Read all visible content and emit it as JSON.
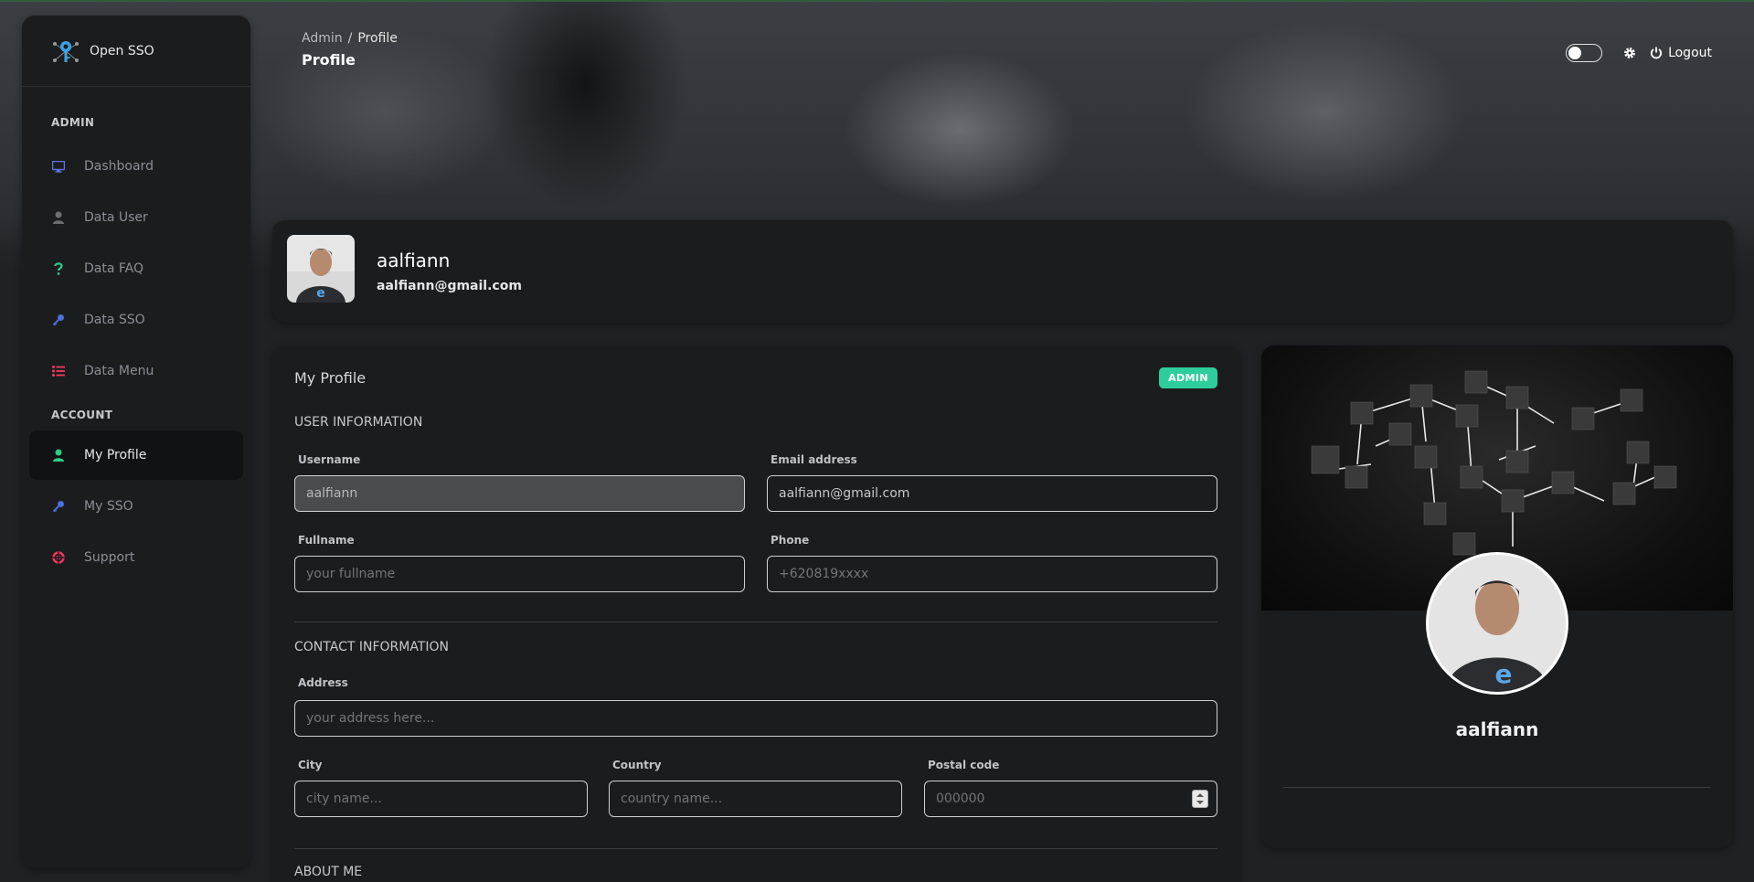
{
  "app": {
    "name": "Open SSO"
  },
  "sidebar": {
    "sections": [
      {
        "label": "ADMIN"
      },
      {
        "label": "ACCOUNT"
      }
    ],
    "items": [
      {
        "label": "Dashboard",
        "icon": "monitor-icon",
        "color": "#5e72e4"
      },
      {
        "label": "Data User",
        "icon": "user-icon",
        "color": "#6c6f73"
      },
      {
        "label": "Data FAQ",
        "icon": "question-icon",
        "color": "#2dce89"
      },
      {
        "label": "Data SSO",
        "icon": "key-icon",
        "color": "#4a6fd8"
      },
      {
        "label": "Data Menu",
        "icon": "list-icon",
        "color": "#f5365c"
      },
      {
        "label": "My Profile",
        "icon": "user-icon",
        "color": "#2dce89"
      },
      {
        "label": "My SSO",
        "icon": "key-icon",
        "color": "#4a6fd8"
      },
      {
        "label": "Support",
        "icon": "lifebuoy-icon",
        "color": "#f5365c"
      }
    ]
  },
  "header": {
    "breadcrumb": {
      "parent": "Admin",
      "separator": "/",
      "current": "Profile"
    },
    "title": "Profile",
    "logout_label": "Logout"
  },
  "profile": {
    "name": "aalfiann",
    "email": "aalfiann@gmail.com"
  },
  "form": {
    "title": "My Profile",
    "badge": "ADMIN",
    "user_info_heading": "USER INFORMATION",
    "contact_info_heading": "CONTACT INFORMATION",
    "about_heading": "ABOUT ME",
    "username": {
      "label": "Username",
      "value": "aalfiann"
    },
    "email": {
      "label": "Email address",
      "value": "aalfiann@gmail.com"
    },
    "fullname": {
      "label": "Fullname",
      "placeholder": "your fullname"
    },
    "phone": {
      "label": "Phone",
      "placeholder": "+620819xxxx"
    },
    "address": {
      "label": "Address",
      "placeholder": "your address here..."
    },
    "city": {
      "label": "City",
      "placeholder": "city name..."
    },
    "country": {
      "label": "Country",
      "placeholder": "country name..."
    },
    "postal": {
      "label": "Postal code",
      "placeholder": "000000"
    }
  },
  "side_card": {
    "name": "aalfiann"
  },
  "colors": {
    "badge": "#2dce9b",
    "background": "#1f2124",
    "card": "#1b1c1e"
  }
}
